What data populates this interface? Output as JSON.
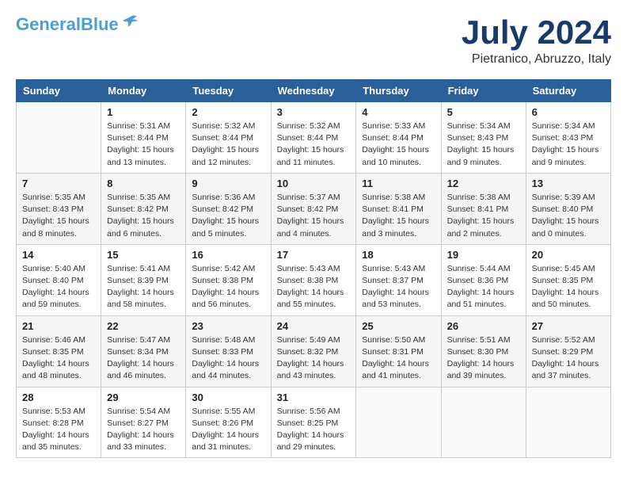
{
  "header": {
    "logo_general": "General",
    "logo_blue": "Blue",
    "month_title": "July 2024",
    "location": "Pietranico, Abruzzo, Italy"
  },
  "days_of_week": [
    "Sunday",
    "Monday",
    "Tuesday",
    "Wednesday",
    "Thursday",
    "Friday",
    "Saturday"
  ],
  "weeks": [
    [
      {
        "day": "",
        "info": ""
      },
      {
        "day": "1",
        "info": "Sunrise: 5:31 AM\nSunset: 8:44 PM\nDaylight: 15 hours\nand 13 minutes."
      },
      {
        "day": "2",
        "info": "Sunrise: 5:32 AM\nSunset: 8:44 PM\nDaylight: 15 hours\nand 12 minutes."
      },
      {
        "day": "3",
        "info": "Sunrise: 5:32 AM\nSunset: 8:44 PM\nDaylight: 15 hours\nand 11 minutes."
      },
      {
        "day": "4",
        "info": "Sunrise: 5:33 AM\nSunset: 8:44 PM\nDaylight: 15 hours\nand 10 minutes."
      },
      {
        "day": "5",
        "info": "Sunrise: 5:34 AM\nSunset: 8:43 PM\nDaylight: 15 hours\nand 9 minutes."
      },
      {
        "day": "6",
        "info": "Sunrise: 5:34 AM\nSunset: 8:43 PM\nDaylight: 15 hours\nand 9 minutes."
      }
    ],
    [
      {
        "day": "7",
        "info": "Sunrise: 5:35 AM\nSunset: 8:43 PM\nDaylight: 15 hours\nand 8 minutes."
      },
      {
        "day": "8",
        "info": "Sunrise: 5:35 AM\nSunset: 8:42 PM\nDaylight: 15 hours\nand 6 minutes."
      },
      {
        "day": "9",
        "info": "Sunrise: 5:36 AM\nSunset: 8:42 PM\nDaylight: 15 hours\nand 5 minutes."
      },
      {
        "day": "10",
        "info": "Sunrise: 5:37 AM\nSunset: 8:42 PM\nDaylight: 15 hours\nand 4 minutes."
      },
      {
        "day": "11",
        "info": "Sunrise: 5:38 AM\nSunset: 8:41 PM\nDaylight: 15 hours\nand 3 minutes."
      },
      {
        "day": "12",
        "info": "Sunrise: 5:38 AM\nSunset: 8:41 PM\nDaylight: 15 hours\nand 2 minutes."
      },
      {
        "day": "13",
        "info": "Sunrise: 5:39 AM\nSunset: 8:40 PM\nDaylight: 15 hours\nand 0 minutes."
      }
    ],
    [
      {
        "day": "14",
        "info": "Sunrise: 5:40 AM\nSunset: 8:40 PM\nDaylight: 14 hours\nand 59 minutes."
      },
      {
        "day": "15",
        "info": "Sunrise: 5:41 AM\nSunset: 8:39 PM\nDaylight: 14 hours\nand 58 minutes."
      },
      {
        "day": "16",
        "info": "Sunrise: 5:42 AM\nSunset: 8:38 PM\nDaylight: 14 hours\nand 56 minutes."
      },
      {
        "day": "17",
        "info": "Sunrise: 5:43 AM\nSunset: 8:38 PM\nDaylight: 14 hours\nand 55 minutes."
      },
      {
        "day": "18",
        "info": "Sunrise: 5:43 AM\nSunset: 8:37 PM\nDaylight: 14 hours\nand 53 minutes."
      },
      {
        "day": "19",
        "info": "Sunrise: 5:44 AM\nSunset: 8:36 PM\nDaylight: 14 hours\nand 51 minutes."
      },
      {
        "day": "20",
        "info": "Sunrise: 5:45 AM\nSunset: 8:35 PM\nDaylight: 14 hours\nand 50 minutes."
      }
    ],
    [
      {
        "day": "21",
        "info": "Sunrise: 5:46 AM\nSunset: 8:35 PM\nDaylight: 14 hours\nand 48 minutes."
      },
      {
        "day": "22",
        "info": "Sunrise: 5:47 AM\nSunset: 8:34 PM\nDaylight: 14 hours\nand 46 minutes."
      },
      {
        "day": "23",
        "info": "Sunrise: 5:48 AM\nSunset: 8:33 PM\nDaylight: 14 hours\nand 44 minutes."
      },
      {
        "day": "24",
        "info": "Sunrise: 5:49 AM\nSunset: 8:32 PM\nDaylight: 14 hours\nand 43 minutes."
      },
      {
        "day": "25",
        "info": "Sunrise: 5:50 AM\nSunset: 8:31 PM\nDaylight: 14 hours\nand 41 minutes."
      },
      {
        "day": "26",
        "info": "Sunrise: 5:51 AM\nSunset: 8:30 PM\nDaylight: 14 hours\nand 39 minutes."
      },
      {
        "day": "27",
        "info": "Sunrise: 5:52 AM\nSunset: 8:29 PM\nDaylight: 14 hours\nand 37 minutes."
      }
    ],
    [
      {
        "day": "28",
        "info": "Sunrise: 5:53 AM\nSunset: 8:28 PM\nDaylight: 14 hours\nand 35 minutes."
      },
      {
        "day": "29",
        "info": "Sunrise: 5:54 AM\nSunset: 8:27 PM\nDaylight: 14 hours\nand 33 minutes."
      },
      {
        "day": "30",
        "info": "Sunrise: 5:55 AM\nSunset: 8:26 PM\nDaylight: 14 hours\nand 31 minutes."
      },
      {
        "day": "31",
        "info": "Sunrise: 5:56 AM\nSunset: 8:25 PM\nDaylight: 14 hours\nand 29 minutes."
      },
      {
        "day": "",
        "info": ""
      },
      {
        "day": "",
        "info": ""
      },
      {
        "day": "",
        "info": ""
      }
    ]
  ]
}
